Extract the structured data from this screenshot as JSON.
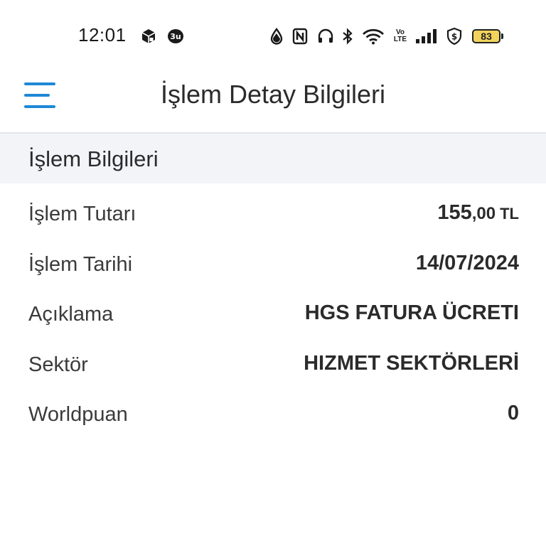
{
  "status_bar": {
    "time": "12:01",
    "battery_level": "83",
    "icons": [
      "package-icon",
      "app-notification-icon",
      "water-drop-icon",
      "nfc-icon",
      "headphones-icon",
      "bluetooth-icon",
      "wifi-icon",
      "volte-icon",
      "signal-icon",
      "shield-dollar-icon",
      "battery-icon"
    ],
    "volte_text_top": "Vo",
    "volte_text_bottom": "LTE"
  },
  "header": {
    "title": "İşlem Detay Bilgileri",
    "accent_color": "#1e88d6"
  },
  "section": {
    "title": "İşlem Bilgileri"
  },
  "details": {
    "amount": {
      "label": "İşlem Tutarı",
      "integer": "155",
      "decimals": ",00",
      "currency": "TL"
    },
    "date": {
      "label": "İşlem Tarihi",
      "value": "14/07/2024"
    },
    "description": {
      "label": "Açıklama",
      "value": "HGS FATURA ÜCRETI"
    },
    "sector": {
      "label": "Sektör",
      "value": "HIZMET SEKTÖRLERİ"
    },
    "worldpuan": {
      "label": "Worldpuan",
      "value": "0"
    }
  }
}
